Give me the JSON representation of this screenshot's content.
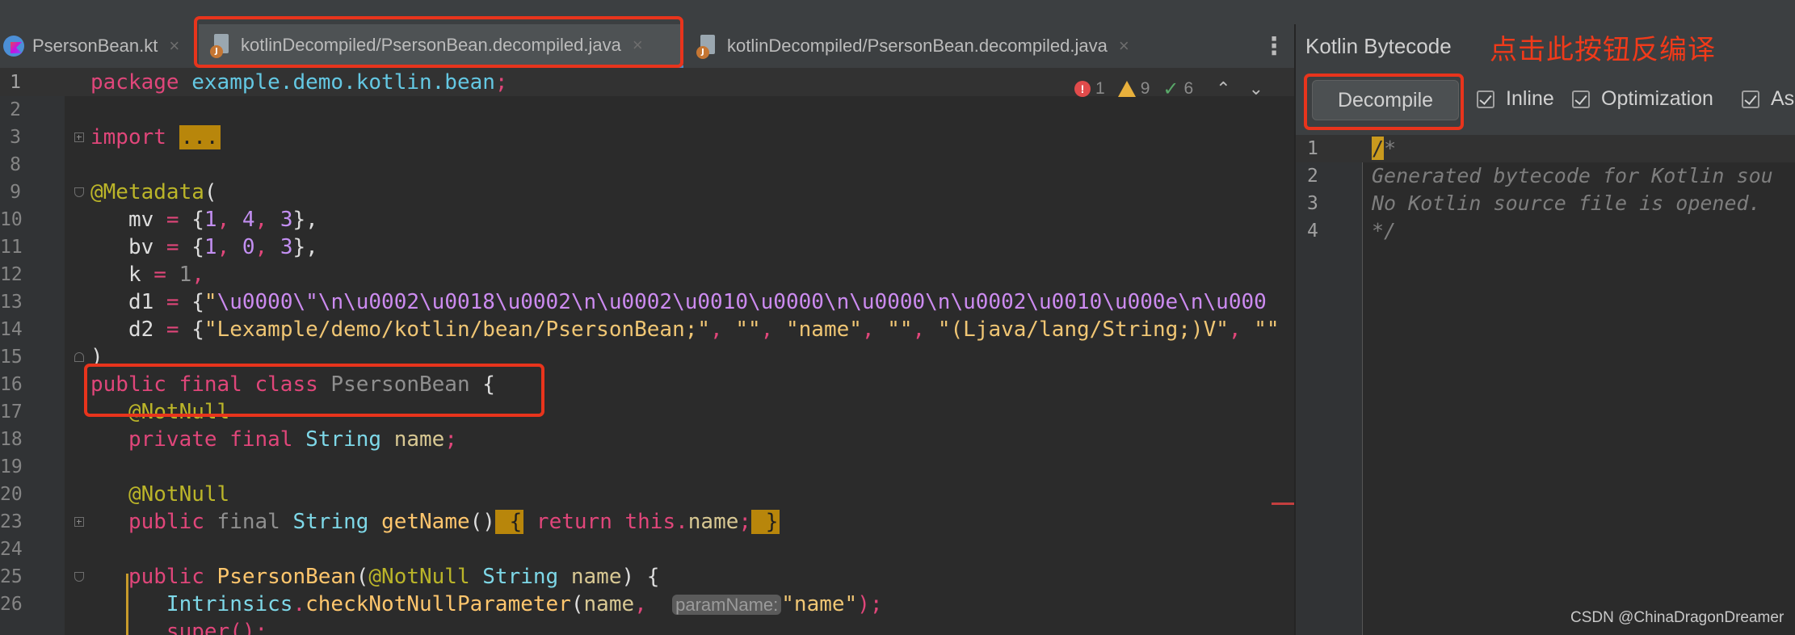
{
  "tabs": [
    {
      "label": "PsersonBean.kt",
      "icon": "kotlin-file-icon",
      "active": false
    },
    {
      "label": "kotlinDecompiled/PsersonBean.decompiled.java",
      "icon": "java-file-icon",
      "active": true
    },
    {
      "label": "kotlinDecompiled/PsersonBean.decompiled.java",
      "icon": "java-file-icon",
      "active": false
    }
  ],
  "tab_close_glyph": "×",
  "more_glyph": "⋮",
  "inspections": {
    "errors": "1",
    "warnings": "9",
    "weak_warnings": "6",
    "error_glyph": "!",
    "ok_glyph": "✓",
    "up_glyph": "⌃",
    "down_glyph": "⌄"
  },
  "editor": {
    "line_numbers": [
      "1",
      "2",
      "3",
      "8",
      "9",
      "10",
      "11",
      "12",
      "13",
      "14",
      "15",
      "16",
      "17",
      "18",
      "19",
      "20",
      "23",
      "24",
      "25",
      "26"
    ],
    "fold_chip": "...",
    "line1": {
      "kw": "package",
      "pkg": "example.demo.kotlin.bean",
      "semi": ";"
    },
    "line3": {
      "kw": "import",
      "chip": "..."
    },
    "line8": {
      "ann": "@Metadata",
      "paren": "("
    },
    "line9": {
      "key": "mv",
      "eq": " = ",
      "open": "{",
      "v1": "1",
      "c1": ", ",
      "v2": "4",
      "c2": ", ",
      "v3": "3",
      "close": "},"
    },
    "line10": {
      "key": "bv",
      "eq": " = ",
      "open": "{",
      "v1": "1",
      "c1": ", ",
      "v2": "0",
      "c2": ", ",
      "v3": "3",
      "close": "},"
    },
    "line11": {
      "key": "k",
      "eq": " = ",
      "v": "1",
      "comma": ","
    },
    "line12": {
      "key": "d1",
      "eq": " = ",
      "open": "{",
      "q": "\"",
      "esc": "\\u0000\\\"\\n\\u0002\\u0018\\u0002\\n\\u0002\\u0010\\u0000\\n\\u0000\\n\\u0002\\u0010\\u000e\\n\\u000"
    },
    "line13": {
      "key": "d2",
      "eq": " = ",
      "open": "{",
      "s1": "\"Lexample/demo/kotlin/bean/PsersonBean;\"",
      "c1": ", ",
      "s2": "\"\"",
      "c2": ", ",
      "s3": "\"name\"",
      "c3": ", ",
      "s4": "\"\"",
      "c4": ", ",
      "s5": "\"(Ljava/lang/String;)V\"",
      "c5": ", ",
      "s6": "\"\""
    },
    "line14": {
      "close": ")"
    },
    "line15": {
      "kw": "public final class",
      "name": "PsersonBean",
      "brace": "{"
    },
    "line16": {
      "ann": "@NotNull"
    },
    "line17": {
      "kw": "private final",
      "type": "String",
      "name": "name",
      "semi": ";"
    },
    "line19": {
      "ann": "@NotNull"
    },
    "line20": {
      "kw1": "public",
      "kw2": "final",
      "type": "String",
      "fn": "getName",
      "parens": "()",
      "chip_open": " {",
      "ret": "return",
      "this": "this",
      "dot": ".",
      "field": "name",
      "semi": ";",
      "chip_close": " }"
    },
    "line24": {
      "kw": "public",
      "fn": "PsersonBean",
      "open": "(",
      "ann": "@NotNull",
      "type": "String",
      "param": "name",
      "close": ") {"
    },
    "line25": {
      "cls": "Intrinsics",
      "dot": ".",
      "fn": "checkNotNullParameter",
      "open": "(",
      "arg": "name",
      "comma": ", ",
      "hint": "paramName:",
      "str": "\"name\"",
      "close": ");"
    },
    "line26": {
      "fn": "super",
      "call": "();"
    }
  },
  "bytecode_panel": {
    "title": "Kotlin Bytecode",
    "annotation": "点击此按钮反编译",
    "decompile_label": "Decompile",
    "options": [
      "Inline",
      "Optimization",
      "As"
    ],
    "line_numbers": [
      "1",
      "2",
      "3",
      "4"
    ],
    "caret_char": "/",
    "lines": [
      "*",
      "Generated bytecode for Kotlin sou",
      "No Kotlin source file is opened.",
      "*/"
    ]
  },
  "watermark": "CSDN @ChinaDragonDreamer",
  "colors": {
    "keyword": "#e0467a",
    "package": "#64c8e3",
    "annotation": "#bbb529",
    "highlight_box": "#e8341c"
  }
}
